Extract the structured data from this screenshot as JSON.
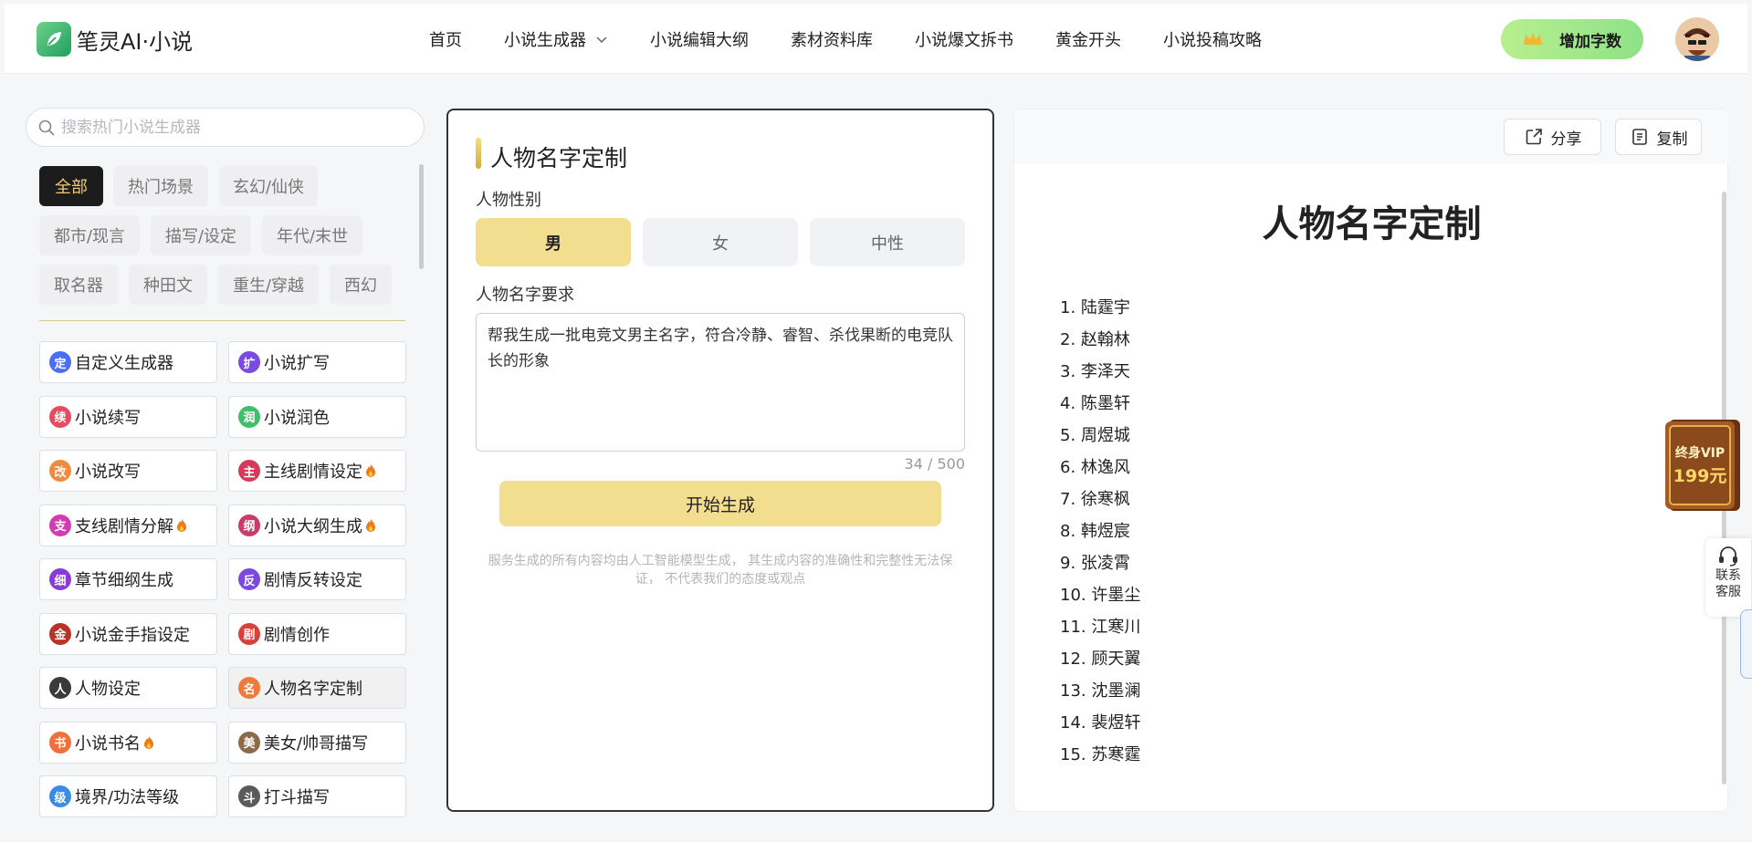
{
  "brand": {
    "name": "笔灵AI·小说"
  },
  "nav": {
    "items": [
      "首页",
      "小说生成器",
      "小说编辑大纲",
      "素材资料库",
      "小说爆文拆书",
      "黄金开头",
      "小说投稿攻略"
    ]
  },
  "header": {
    "add_words_label": "增加字数"
  },
  "sidebar": {
    "search_placeholder": "搜索热门小说生成器",
    "categories": [
      "全部",
      "热门场景",
      "玄幻/仙侠",
      "都市/现言",
      "描写/设定",
      "年代/末世",
      "取名器",
      "种田文",
      "重生/穿越",
      "西幻"
    ],
    "active_category": "全部",
    "tools": [
      {
        "label": "自定义生成器",
        "icon": "定",
        "color": "#4a6cf7"
      },
      {
        "label": "小说扩写",
        "icon": "扩",
        "color": "#7b4ae0"
      },
      {
        "label": "小说续写",
        "icon": "续",
        "color": "#e84a5f"
      },
      {
        "label": "小说润色",
        "icon": "润",
        "color": "#3fbf6a"
      },
      {
        "label": "小说改写",
        "icon": "改",
        "color": "#f08a3c"
      },
      {
        "label": "主线剧情设定",
        "icon": "主",
        "color": "#d63a5a",
        "hot": true
      },
      {
        "label": "支线剧情分解",
        "icon": "支",
        "color": "#d43bb0",
        "hot": true
      },
      {
        "label": "小说大纲生成",
        "icon": "纲",
        "color": "#cc3a6a",
        "hot": true
      },
      {
        "label": "章节细纲生成",
        "icon": "细",
        "color": "#8a3ad8"
      },
      {
        "label": "剧情反转设定",
        "icon": "反",
        "color": "#7a4ae0"
      },
      {
        "label": "小说金手指设定",
        "icon": "金",
        "color": "#b8322a"
      },
      {
        "label": "剧情创作",
        "icon": "剧",
        "color": "#d8413a"
      },
      {
        "label": "人物设定",
        "icon": "人",
        "color": "#3a3a3a"
      },
      {
        "label": "人物名字定制",
        "icon": "名",
        "color": "#f07a3c",
        "selected": true
      },
      {
        "label": "小说书名",
        "icon": "书",
        "color": "#f0703c",
        "hot": true
      },
      {
        "label": "美女/帅哥描写",
        "icon": "美",
        "color": "#8a6a4a"
      },
      {
        "label": "境界/功法等级",
        "icon": "级",
        "color": "#3a8ae8"
      },
      {
        "label": "打斗描写",
        "icon": "斗",
        "color": "#5a5a5a"
      }
    ]
  },
  "form": {
    "title": "人物名字定制",
    "gender_label": "人物性别",
    "genders": [
      "男",
      "女",
      "中性"
    ],
    "selected_gender": "男",
    "requirement_label": "人物名字要求",
    "requirement_value": "帮我生成一批电竞文男主名字，符合冷静、睿智、杀伐果断的电竞队长的形象",
    "counter": "34 / 500",
    "generate_label": "开始生成",
    "disclaimer": "服务生成的所有内容均由人工智能模型生成， 其生成内容的准确性和完整性无法保证， 不代表我们的态度或观点"
  },
  "result": {
    "share_label": "分享",
    "copy_label": "复制",
    "title": "人物名字定制",
    "names": [
      "1. 陆霆宇",
      "2. 赵翰林",
      "3. 李泽天",
      "4. 陈墨轩",
      "5. 周煜城",
      "6. 林逸风",
      "7. 徐寒枫",
      "8. 韩煜宸",
      "9. 张凌霄",
      "10. 许墨尘",
      "11. 江寒川",
      "12. 顾天翼",
      "13. 沈墨澜",
      "14. 裴煜轩",
      "15. 苏寒霆"
    ]
  },
  "float": {
    "vip_line1": "终身VIP",
    "vip_line2": "199元",
    "service_label": "联系客服"
  }
}
